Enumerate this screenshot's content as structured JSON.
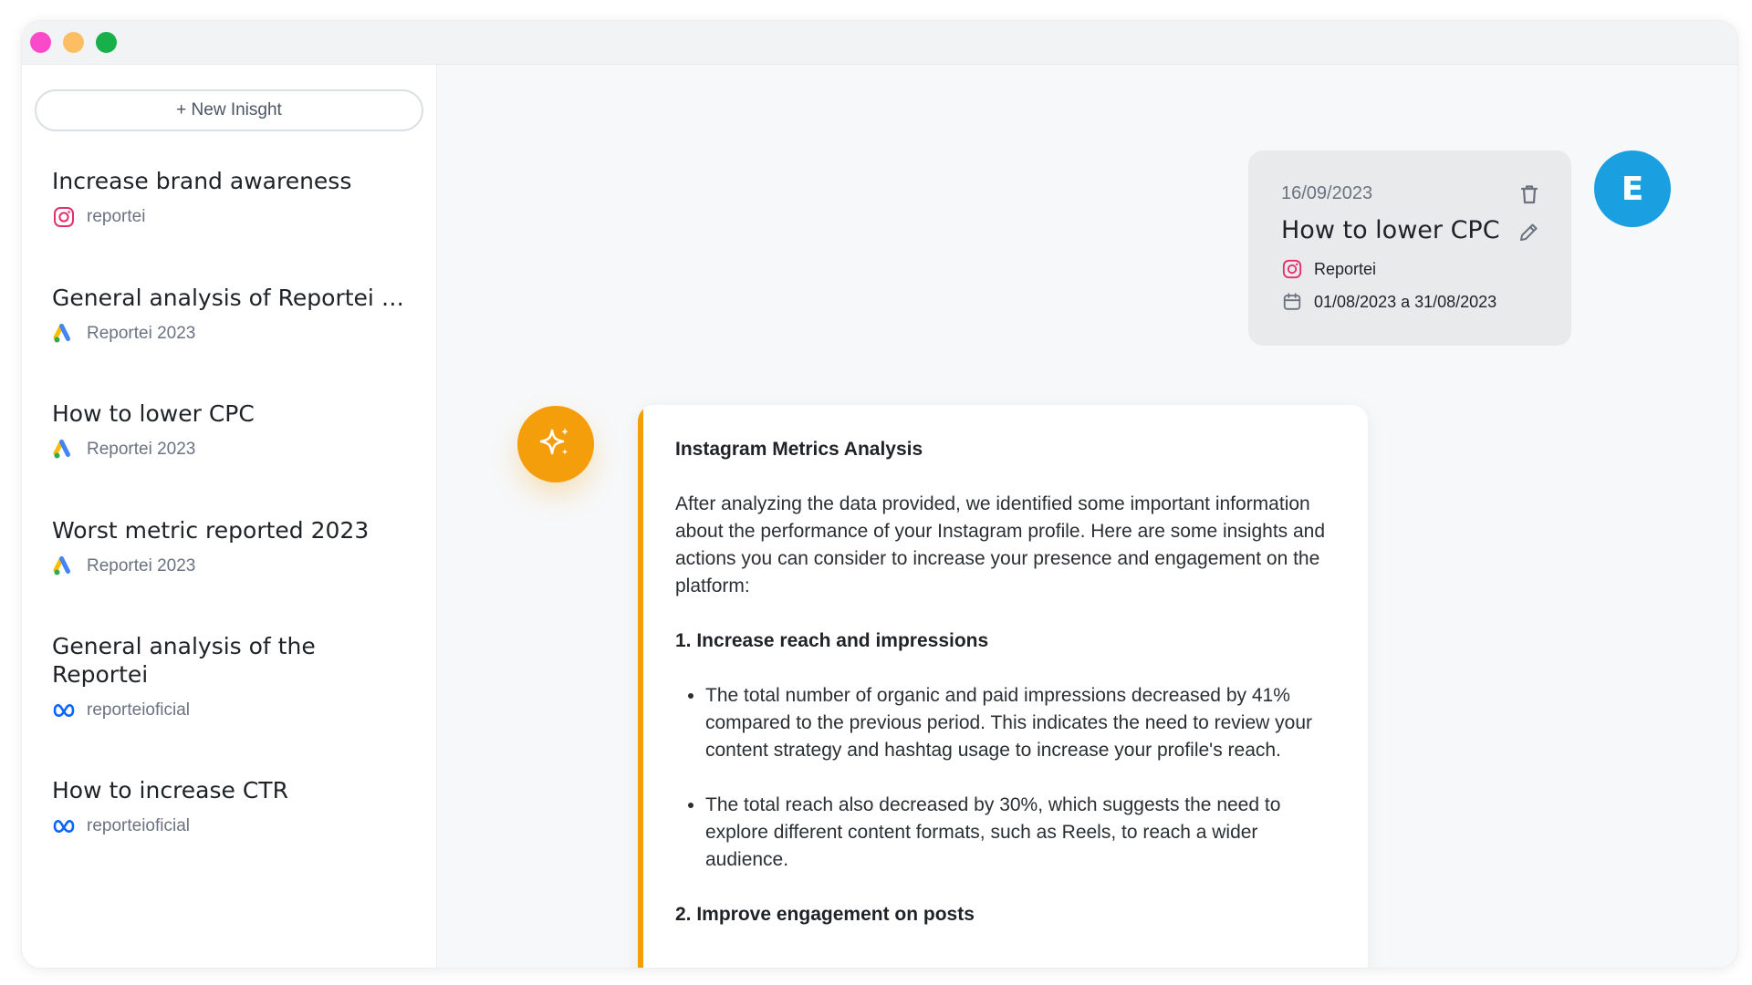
{
  "window": {
    "traffic_lights": [
      "close",
      "minimize",
      "maximize"
    ]
  },
  "sidebar": {
    "new_button_label": "+ New Inisght",
    "items": [
      {
        "title": "Increase brand awareness",
        "source": "reportei",
        "icon": "instagram-icon"
      },
      {
        "title": "General analysis of Reportei 2…",
        "source": "Reportei 2023",
        "icon": "google-ads-icon"
      },
      {
        "title": "How to lower CPC",
        "source": "Reportei 2023",
        "icon": "google-ads-icon"
      },
      {
        "title": "Worst metric reported 2023",
        "source": "Reportei 2023",
        "icon": "google-ads-icon"
      },
      {
        "title": "General analysis of the Reportei",
        "source": "reporteioficial",
        "icon": "meta-icon"
      },
      {
        "title": "How to increase CTR",
        "source": "reporteioficial",
        "icon": "meta-icon"
      }
    ]
  },
  "query": {
    "date": "16/09/2023",
    "title": "How to lower CPC",
    "account": "Reportei",
    "period": "01/08/2023 a 31/08/2023"
  },
  "user": {
    "initial": "E"
  },
  "answer": {
    "heading": "Instagram Metrics Analysis",
    "intro": "After analyzing the data provided, we identified some important information about the performance of your Instagram profile. Here are some insights and actions you can consider to increase your presence and engagement on the platform:",
    "section1_title": "1. Increase reach and impressions",
    "section1_bullets": [
      "The total number of organic and paid impressions decreased by 41% compared to the previous period. This indicates the need to review your content strategy and hashtag usage to increase your profile's reach.",
      "The total reach also decreased by 30%, which suggests the need to explore different content formats, such as Reels, to reach a wider audience."
    ],
    "section2_title": "2. Improve engagement on posts"
  },
  "colors": {
    "accent_orange": "#f59e0b",
    "avatar_blue": "#1a9fe0",
    "instagram_pink": "#e1306c",
    "meta_blue": "#0866ff"
  }
}
